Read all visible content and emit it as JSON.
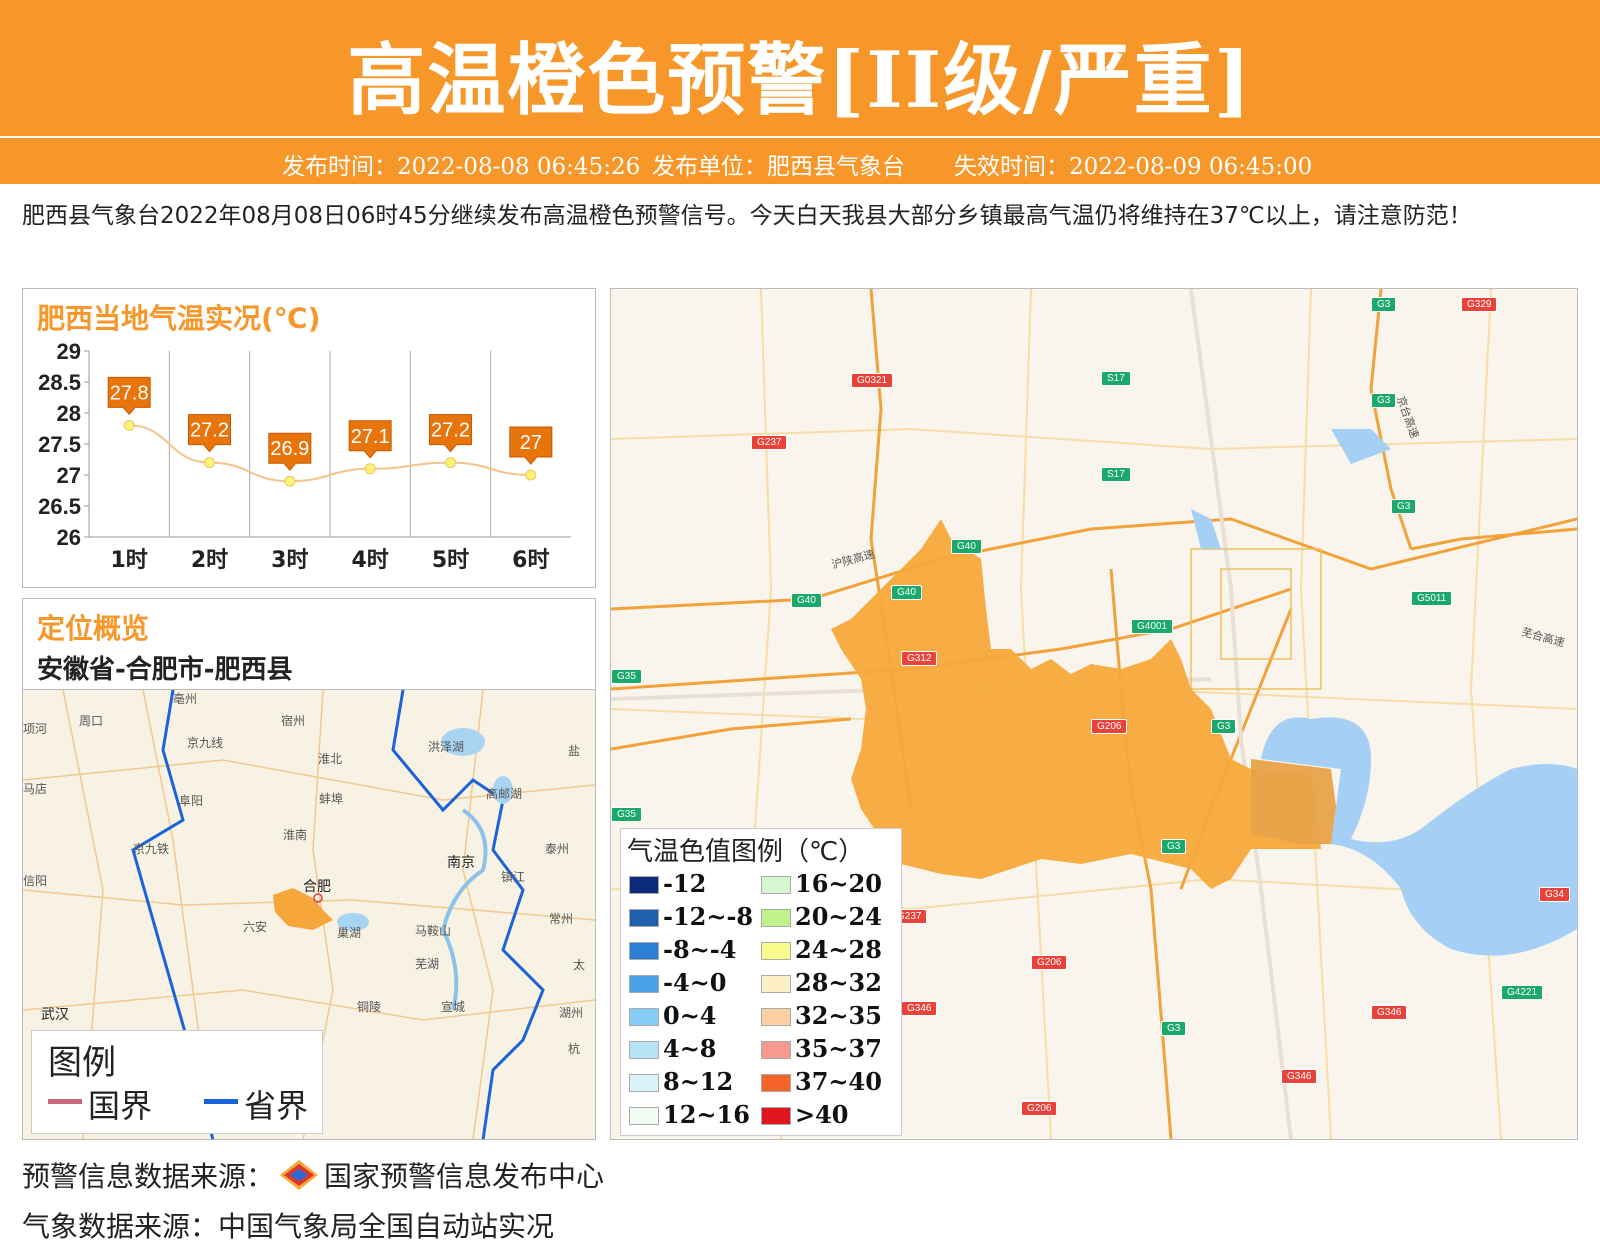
{
  "header": {
    "title": "高温橙色预警[II级/严重]",
    "publish_time": "发布时间：2022-08-08 06:45:26",
    "publisher": "发布单位：肥西县气象台",
    "expire_time": "失效时间：2022-08-09 06:45:00"
  },
  "description": "肥西县气象台2022年08月08日06时45分继续发布高温橙色预警信号。今天白天我县大部分乡镇最高气温仍将维持在37℃以上，请注意防范！",
  "temp_panel": {
    "title": "肥西当地气温实况(℃)"
  },
  "chart_data": {
    "type": "line",
    "categories": [
      "1时",
      "2时",
      "3时",
      "4时",
      "5时",
      "6时"
    ],
    "values": [
      27.8,
      27.2,
      26.9,
      27.1,
      27.2,
      27
    ],
    "value_labels": [
      "27.8",
      "27.2",
      "26.9",
      "27.1",
      "27.2",
      "27"
    ],
    "ylim": [
      26,
      29
    ],
    "yticks": [
      "29",
      "28.5",
      "28",
      "27.5",
      "27",
      "26.5",
      "26"
    ],
    "title": "肥西当地气温实况(℃)",
    "grid": "vertical",
    "colors": {
      "line": "#f5c28a",
      "label_bg": "#e8740c",
      "point": "#fff176"
    }
  },
  "location_panel": {
    "title": "定位概览",
    "path": "安徽省-合肥市-肥西县",
    "map_labels": [
      "亳州",
      "宿州",
      "周口",
      "项河",
      "淮北",
      "洪泽湖",
      "盐",
      "马店",
      "阜阳",
      "蚌埠",
      "高邮湖",
      "淮南",
      "南京",
      "泰州",
      "信阳",
      "合肥",
      "镇江",
      "六安",
      "巢湖",
      "马鞍山",
      "常州",
      "芜湖",
      "太",
      "武汉",
      "铜陵",
      "宣城",
      "湖州",
      "杭",
      "京九线",
      "京九铁"
    ],
    "legend": {
      "title": "图例",
      "items": [
        {
          "label": "国界",
          "color": "#c56a75"
        },
        {
          "label": "省界",
          "color": "#1a63d8"
        }
      ]
    }
  },
  "main_map": {
    "road_labels": [
      "G3",
      "G329",
      "G0321",
      "S17",
      "G237",
      "G3",
      "S17",
      "G3",
      "G40",
      "G40",
      "G40",
      "G4001",
      "G5011",
      "G312",
      "G35",
      "G206",
      "G3",
      "G35",
      "G3",
      "G237",
      "G206",
      "G346",
      "G3",
      "G34",
      "G4221",
      "G346",
      "G346",
      "G206"
    ],
    "place_labels": [
      "沪陕高速",
      "京台高速",
      "芜合高速"
    ],
    "legend": {
      "title": "气温色值图例（℃）",
      "items": [
        {
          "label": "-12",
          "color": "#0a2a7a"
        },
        {
          "label": "-12~-8",
          "color": "#1e5fae"
        },
        {
          "label": "-8~-4",
          "color": "#2b7fd6"
        },
        {
          "label": "-4~0",
          "color": "#4aa3e6"
        },
        {
          "label": "0~4",
          "color": "#86cdf5"
        },
        {
          "label": "4~8",
          "color": "#b7e3f7"
        },
        {
          "label": "8~12",
          "color": "#d9f3fb"
        },
        {
          "label": "12~16",
          "color": "#f0fbf2"
        },
        {
          "label": "16~20",
          "color": "#d4f7d0"
        },
        {
          "label": "20~24",
          "color": "#c2f28e"
        },
        {
          "label": "24~28",
          "color": "#fbfa8e"
        },
        {
          "label": "28~32",
          "color": "#fdf0c4"
        },
        {
          "label": "32~35",
          "color": "#fbd0a4"
        },
        {
          "label": "35~37",
          "color": "#f69b8e"
        },
        {
          "label": "37~40",
          "color": "#f5632a"
        },
        {
          "label": ">40",
          "color": "#e0151f"
        }
      ]
    }
  },
  "footer": {
    "warning_source": "预警信息数据来源：",
    "warning_center": "国家预警信息发布中心",
    "weather_source": "气象数据来源：中国气象局全国自动站实况"
  }
}
